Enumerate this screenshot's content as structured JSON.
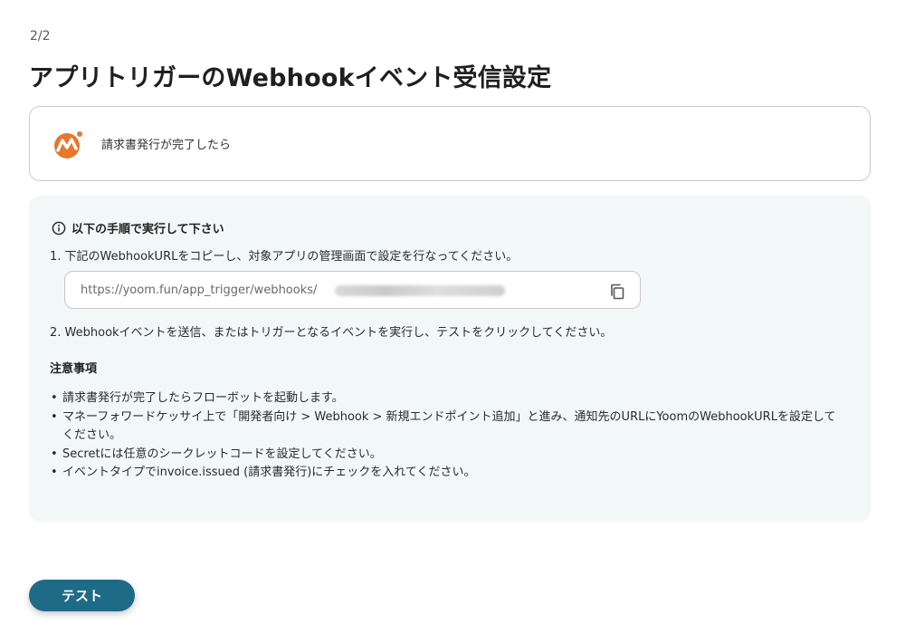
{
  "header": {
    "step": "2/2",
    "title": "アプリトリガーのWebhookイベント受信設定"
  },
  "trigger": {
    "label": "請求書発行が完了したら",
    "app_icon": "moneyforward-logo",
    "brand_color": "#e8772e"
  },
  "instructions": {
    "heading": "以下の手順で実行して下さい",
    "step1": "1. 下記のWebhookURLをコピーし、対象アプリの管理画面で設定を行なってください。",
    "webhook_url": "https://yoom.fun/app_trigger/webhooks/",
    "copy_icon": "copy-icon",
    "step2": "2. Webhookイベントを送信、またはトリガーとなるイベントを実行し、テストをクリックしてください。",
    "notes_title": "注意事項",
    "notes": [
      "請求書発行が完了したらフローボットを起動します。",
      "マネーフォワードケッサイ上で「開発者向け > Webhook > 新規エンドポイント追加」と進み、通知先のURLにYoomのWebhookURLを設定してください。",
      "Secretには任意のシークレットコードを設定してください。",
      "イベントタイプでinvoice.issued (請求書発行)にチェックを入れてください。"
    ],
    "background_color": "#f2f7f7"
  },
  "actions": {
    "test_label": "テスト",
    "button_color": "#1e6b87"
  }
}
